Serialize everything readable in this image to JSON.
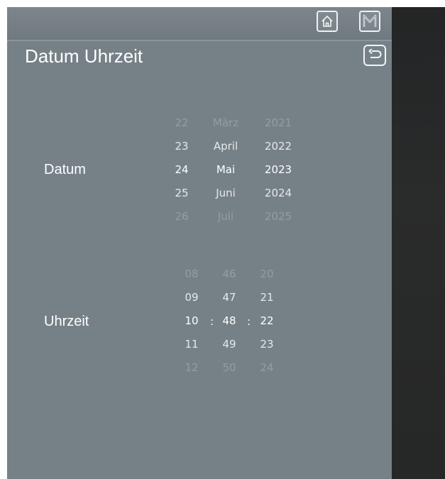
{
  "header": {
    "title": "Datum Uhrzeit"
  },
  "topbar": {
    "home_icon": "home-icon",
    "menu_icon": "m-menu-icon",
    "back_icon": "back-arrow-icon"
  },
  "date_picker": {
    "label": "Datum",
    "days": [
      "22",
      "23",
      "24",
      "25",
      "26"
    ],
    "months": [
      "März",
      "April",
      "Mai",
      "Juni",
      "Juli"
    ],
    "years": [
      "2021",
      "2022",
      "2023",
      "2024",
      "2025"
    ],
    "selected": {
      "day": "24",
      "month": "Mai",
      "year": "2023"
    }
  },
  "time_picker": {
    "label": "Uhrzeit",
    "hours": [
      "08",
      "09",
      "10",
      "11",
      "12"
    ],
    "minutes": [
      "46",
      "47",
      "48",
      "49",
      "50"
    ],
    "seconds": [
      "20",
      "21",
      "22",
      "23",
      "24"
    ],
    "separator": ":",
    "selected": {
      "hour": "10",
      "minute": "48",
      "second": "22"
    }
  }
}
